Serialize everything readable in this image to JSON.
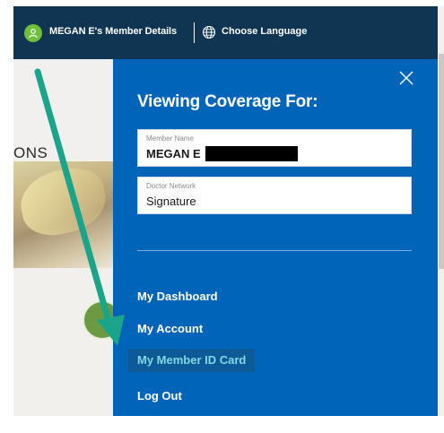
{
  "topbar": {
    "member_details": "MEGAN E's Member Details",
    "language_label": "Choose Language",
    "avatar_icon": "user-icon",
    "language_icon": "globe-icon"
  },
  "background": {
    "partial_heading": "ONS"
  },
  "panel": {
    "title": "Viewing Coverage For:",
    "member_field": {
      "label": "Member Name",
      "value": "MEGAN E"
    },
    "network_field": {
      "label": "Doctor Network",
      "value": "Signature"
    },
    "close_icon": "close-icon",
    "nav": [
      {
        "label": "My Dashboard",
        "active": false
      },
      {
        "label": "My Account",
        "active": false
      },
      {
        "label": "My Member ID Card",
        "active": true
      },
      {
        "label": "Log Out",
        "active": false
      }
    ]
  },
  "colors": {
    "topbar": "#0f3552",
    "panel": "#0064b8",
    "active_item_bg": "#0d5a97",
    "active_item_text": "#7fd8e3",
    "annotation_arrow": "#1aa58a"
  }
}
